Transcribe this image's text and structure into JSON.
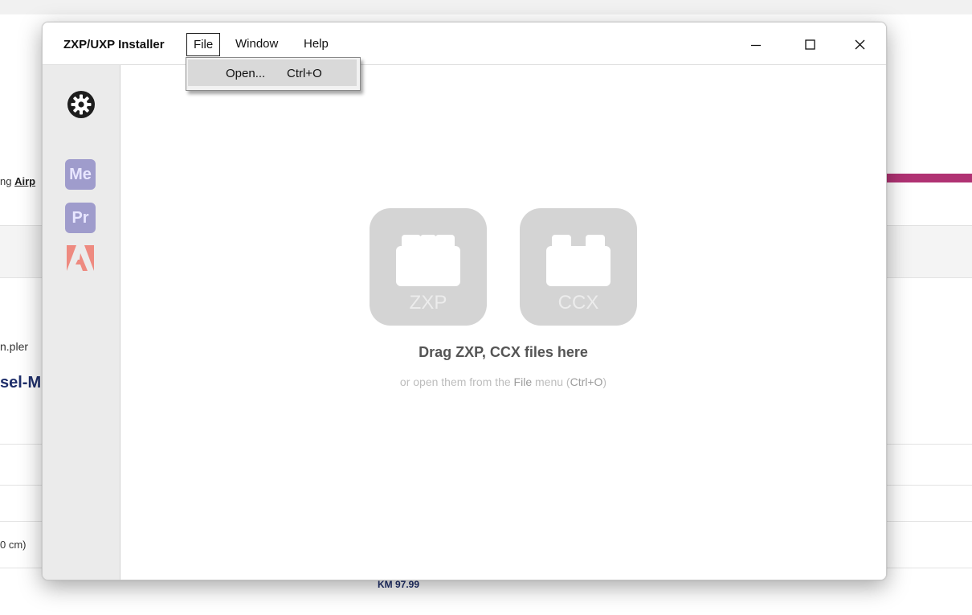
{
  "background_page": {
    "airline_prefix": "ng ",
    "airline_link": "Airp",
    "url_fragment": "n.pler",
    "product_fragment": "sel-M",
    "size_fragment": "0 cm)",
    "price": "KM 97.99",
    "accent_color": "#b03273"
  },
  "window": {
    "title": "ZXP/UXP Installer",
    "menu": {
      "file": "File",
      "window": "Window",
      "help": "Help"
    },
    "controls": {
      "minimize_icon": "minimize-icon",
      "maximize_icon": "maximize-icon",
      "close_icon": "close-icon"
    }
  },
  "file_menu": {
    "items": [
      {
        "label": "Open...",
        "shortcut": "Ctrl+O"
      }
    ]
  },
  "sidebar": {
    "settings_icon": "gear-icon",
    "apps": [
      {
        "label": "Me",
        "name": "media-encoder"
      },
      {
        "label": "Pr",
        "name": "premiere-pro"
      },
      {
        "label": "",
        "name": "adobe"
      }
    ]
  },
  "main": {
    "packages": [
      {
        "label": "ZXP"
      },
      {
        "label": "CCX"
      }
    ],
    "drag_text": "Drag ZXP, CCX files here",
    "hint_prefix": "or open them from the ",
    "hint_menu": "File",
    "hint_middle": " menu (",
    "hint_shortcut": "Ctrl+O",
    "hint_suffix": ")"
  },
  "colors": {
    "sidebar_app_icon": "#9f9ccc",
    "adobe_red": "#ee8a80",
    "package_tile": "#d4d4d4"
  }
}
